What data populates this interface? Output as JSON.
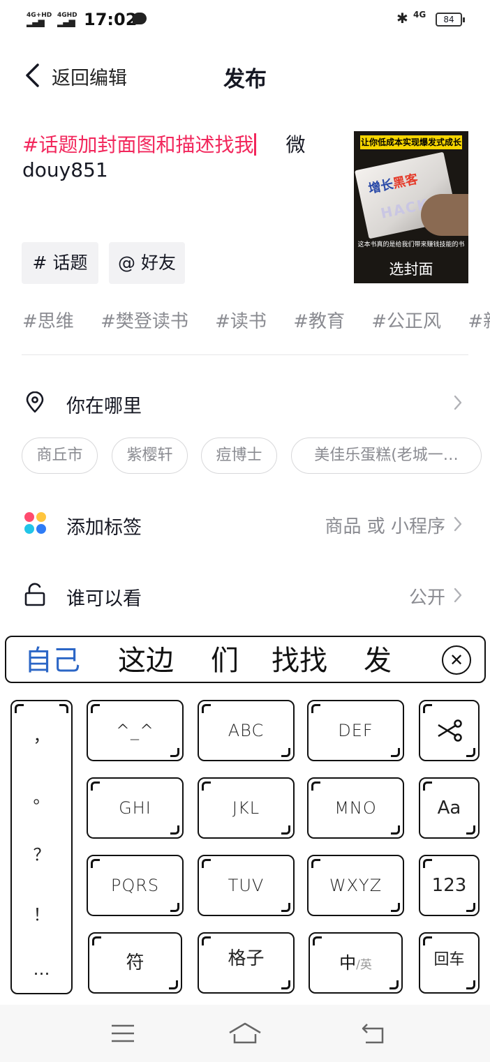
{
  "status_bar": {
    "signal1": "4G+HD",
    "signal2": "4GHD",
    "time": "17:02",
    "network": "4G",
    "battery": "84"
  },
  "header": {
    "back_label": "返回编辑",
    "title": "发布"
  },
  "description": {
    "hashtag_text": "#话题加封面图和描述找我",
    "rest_text": "微",
    "line2": "douy851"
  },
  "cover": {
    "banner": "让你低成本实现爆发式成长",
    "book_title_blue": "增长",
    "book_title_red": "黑客",
    "book_subtitle": "HACK",
    "caption": "这本书真的是给我们带来赚钱技能的书",
    "select_label": "选封面"
  },
  "chips": {
    "topic": "# 话题",
    "friend": "@ 好友"
  },
  "hashtag_suggestions": [
    "#思维",
    "#樊登读书",
    "#读书",
    "#教育",
    "#公正风",
    "#新"
  ],
  "location": {
    "label": "你在哪里",
    "suggestions": [
      "商丘市",
      "紫樱轩",
      "痘博士",
      "美佳乐蛋糕(老城一…"
    ]
  },
  "tags": {
    "label": "添加标签",
    "value": "商品 或 小程序"
  },
  "visibility": {
    "label": "谁可以看",
    "value": "公开"
  },
  "ime": {
    "candidates": [
      "自己",
      "这边",
      "们",
      "找找",
      "发"
    ],
    "punctuation": [
      "，",
      "。",
      "？",
      "！",
      "…"
    ],
    "keys": {
      "k1": "^_^",
      "k2": "ABC",
      "k3": "DEF",
      "k4": "GHI",
      "k5": "JKL",
      "k6": "MNO",
      "k7": "PQRS",
      "k8": "TUV",
      "k9": "WXYZ",
      "symbol": "符",
      "space": "格子",
      "lang_main": "中",
      "lang_alt": "/英",
      "case": "Aa",
      "numbers": "123",
      "enter": "回车"
    }
  },
  "colors": {
    "accent": "#f2275c",
    "candidate_highlight": "#2b66c6",
    "muted_text": "#8a8b91"
  }
}
